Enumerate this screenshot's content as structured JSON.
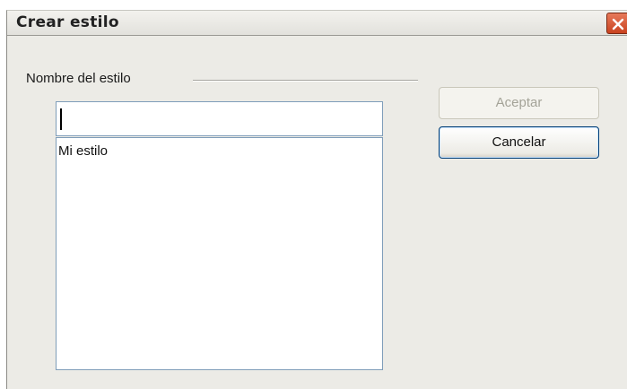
{
  "dialog": {
    "title": "Crear estilo"
  },
  "style_name": {
    "group_label": "Nombre del estilo",
    "input_value": "",
    "list_items": [
      "Mi estilo"
    ]
  },
  "buttons": {
    "accept_label": "Aceptar",
    "accept_enabled": false,
    "cancel_label": "Cancelar"
  },
  "icons": {
    "close": "close-icon"
  },
  "colors": {
    "close_button": "#c9421f",
    "dialog_background": "#ecebe6",
    "field_border": "#7f9db9",
    "cancel_border": "#003c74"
  }
}
